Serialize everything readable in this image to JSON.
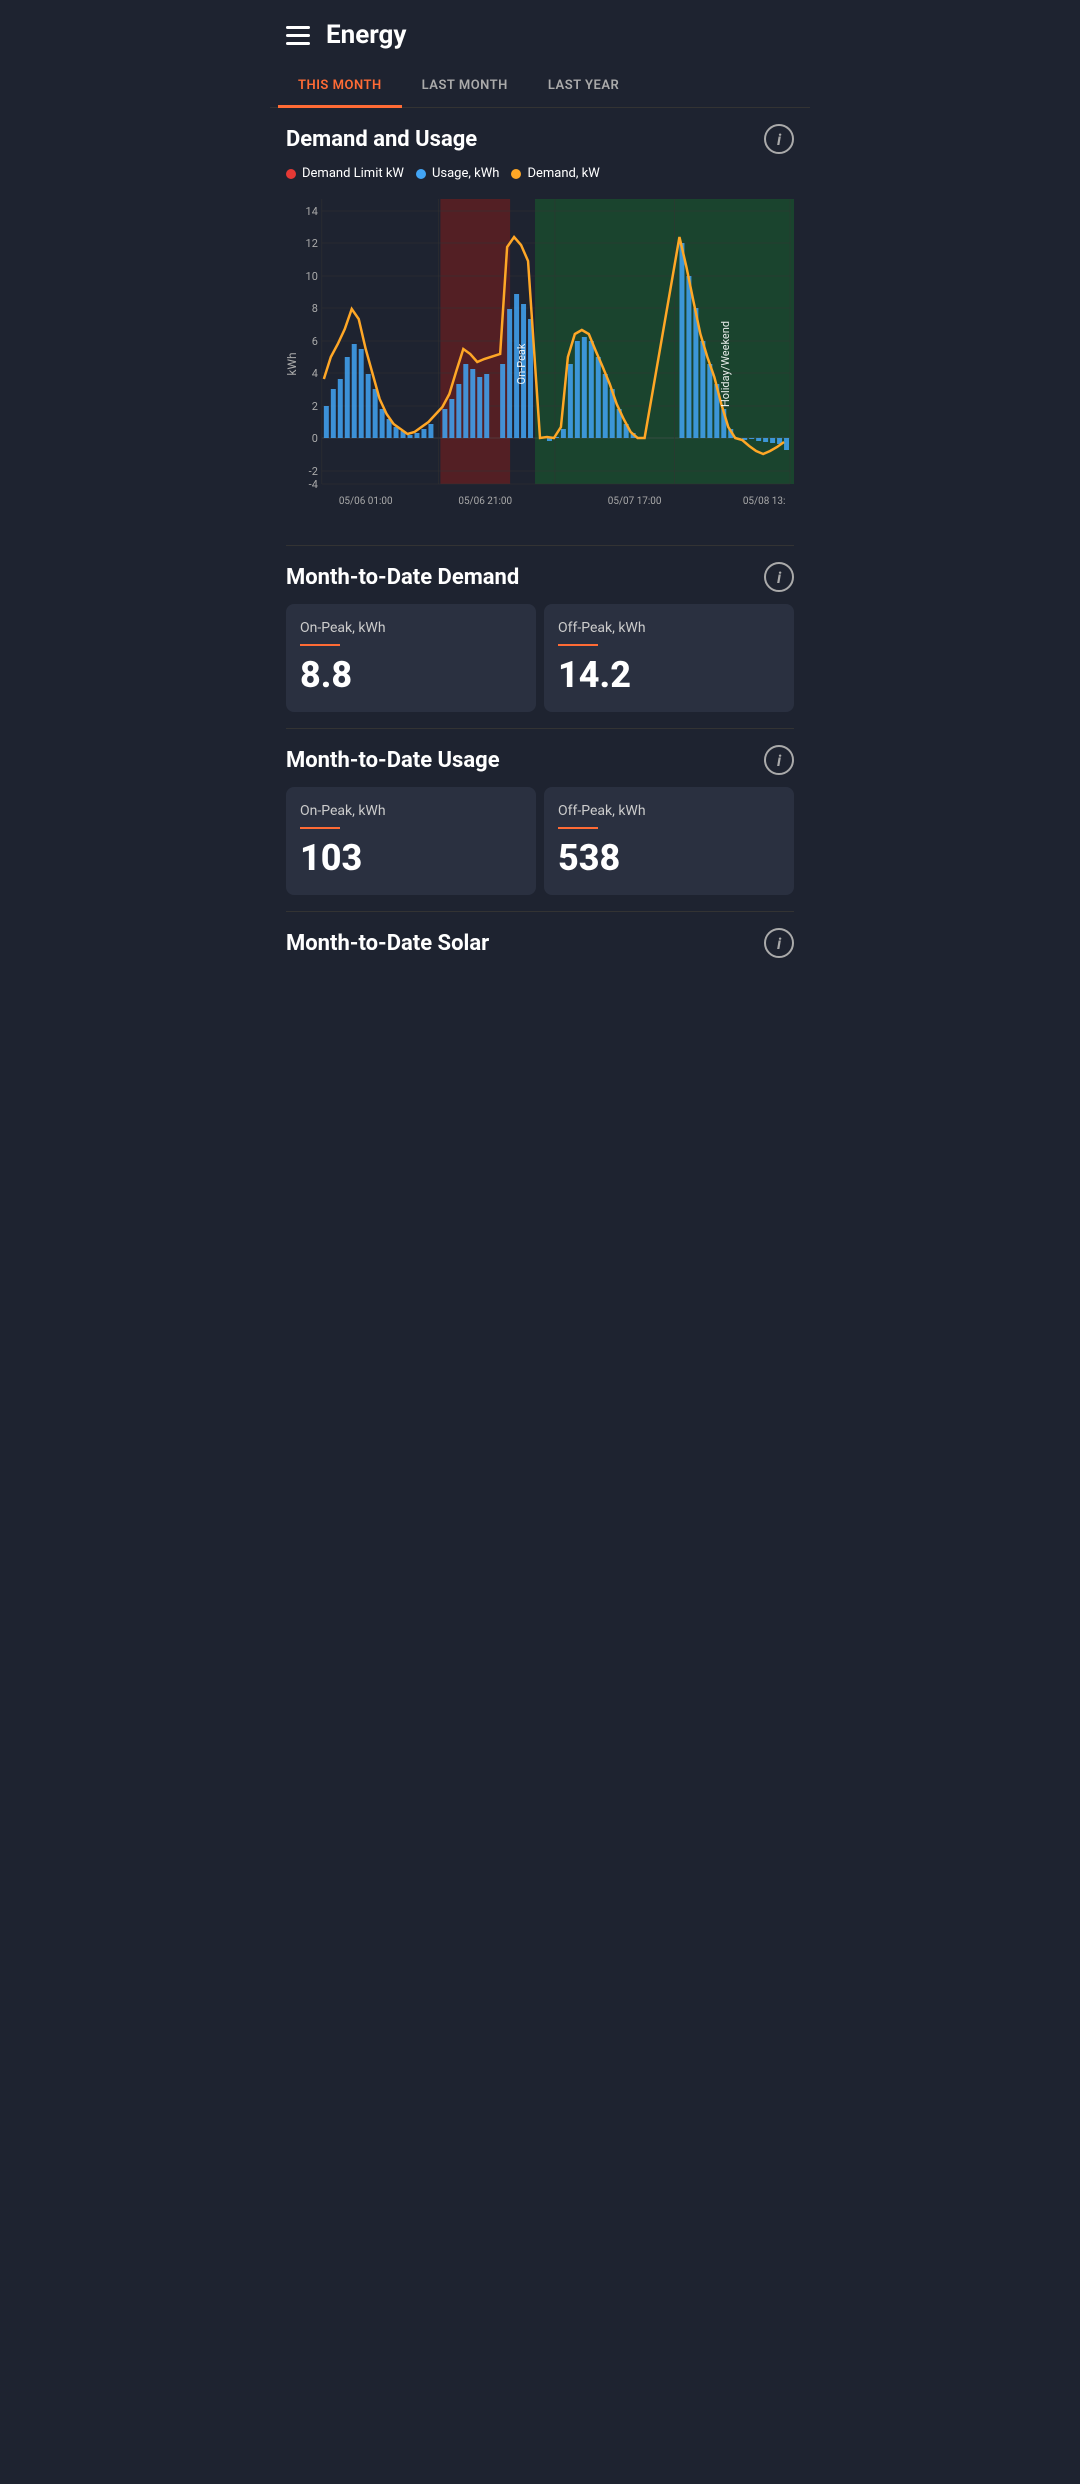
{
  "header": {
    "title": "Energy"
  },
  "tabs": [
    {
      "label": "THIS MONTH",
      "active": true
    },
    {
      "label": "LAST MONTH",
      "active": false
    },
    {
      "label": "LAST YEAR",
      "active": false
    }
  ],
  "demand_usage_section": {
    "title": "Demand and Usage",
    "legend": [
      {
        "label": "Demand Limit kW",
        "color": "#e53935"
      },
      {
        "label": "Usage, kWh",
        "color": "#42a5f5"
      },
      {
        "label": "Demand, kW",
        "color": "#ffa726"
      }
    ],
    "chart": {
      "y_label": "kWh",
      "y_max": 14,
      "y_min": -4,
      "x_labels": [
        "05/06 01:00",
        "05/06 21:00",
        "05/07 17:00",
        "05/08 13:"
      ],
      "annotations": [
        {
          "label": "On-Peak",
          "type": "on-peak"
        },
        {
          "label": "Holiday/Weekend",
          "type": "holiday"
        },
        {
          "label": "Holiday/Weekend",
          "type": "holiday"
        }
      ]
    }
  },
  "month_to_date_demand": {
    "title": "Month-to-Date Demand",
    "on_peak_label": "On-Peak, kWh",
    "on_peak_value": "8.8",
    "off_peak_label": "Off-Peak, kWh",
    "off_peak_value": "14.2"
  },
  "month_to_date_usage": {
    "title": "Month-to-Date Usage",
    "on_peak_label": "On-Peak, kWh",
    "on_peak_value": "103",
    "off_peak_label": "Off-Peak, kWh",
    "off_peak_value": "538"
  },
  "month_to_date_solar": {
    "title": "Month-to-Date Solar"
  },
  "colors": {
    "accent": "#ff6b35",
    "active_tab": "#ff6b35",
    "demand_limit": "#e53935",
    "usage": "#42a5f5",
    "demand": "#ffa726",
    "on_peak_bg": "#5d1e22",
    "holiday_bg": "#1a4a2e",
    "background": "#1e2330",
    "card_bg": "#2a3040"
  }
}
